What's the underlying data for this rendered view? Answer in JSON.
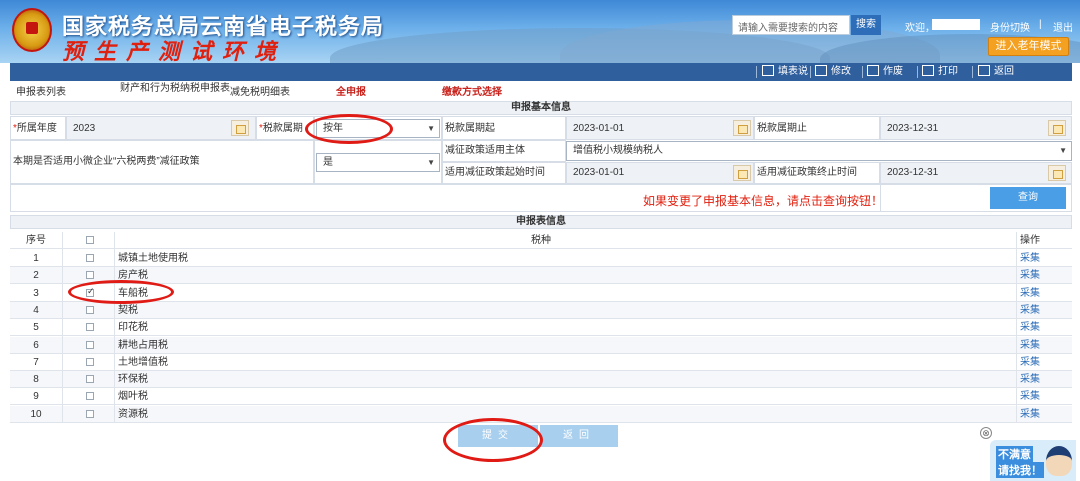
{
  "header": {
    "title": "国家税务总局云南省电子税务局",
    "env_title": "预生产测试环境",
    "search_placeholder": "请输入需要搜索的内容",
    "search_button": "搜索",
    "welcome": "欢迎，",
    "switch_identity": "身份切换",
    "separator": "|",
    "logout": "退出",
    "elder_mode": "进入老年模式"
  },
  "toolbar": {
    "items": [
      "填表说",
      "修改",
      "作废",
      "打印",
      "返回"
    ]
  },
  "tabs": [
    "申报表列表",
    "财产和行为税纳税申报表",
    "减免税明细表",
    "全申报",
    "缴款方式选择"
  ],
  "basic_info": {
    "section_title": "申报基本信息",
    "year_label": "所属年度",
    "year_value": "2023",
    "period_label": "税款属期",
    "period_value": "按年",
    "start_label": "税款属期起",
    "start_value": "2023-01-01",
    "end_label": "税款属期止",
    "end_value": "2023-12-31",
    "policy_label": "本期是否适用小微企业“六税两费”减征政策",
    "policy_value": "是",
    "subject_label": "减征政策适用主体",
    "subject_value": "增值税小规模纳税人",
    "policy_start_label": "适用减征政策起始时间",
    "policy_start_value": "2023-01-01",
    "policy_end_label": "适用减征政策终止时间",
    "policy_end_value": "2023-12-31",
    "notice": "如果变更了申报基本信息，请点击查询按钮！",
    "query_button": "查询"
  },
  "tax_table": {
    "section_title": "申报表信息",
    "headers": {
      "no": "序号",
      "name": "税种",
      "op": "操作"
    },
    "rows": [
      {
        "no": "1",
        "name": "城镇土地使用税",
        "checked": false,
        "op": "采集"
      },
      {
        "no": "2",
        "name": "房产税",
        "checked": false,
        "op": "采集"
      },
      {
        "no": "3",
        "name": "车船税",
        "checked": true,
        "op": "采集"
      },
      {
        "no": "4",
        "name": "契税",
        "checked": false,
        "op": "采集"
      },
      {
        "no": "5",
        "name": "印花税",
        "checked": false,
        "op": "采集"
      },
      {
        "no": "6",
        "name": "耕地占用税",
        "checked": false,
        "op": "采集"
      },
      {
        "no": "7",
        "name": "土地增值税",
        "checked": false,
        "op": "采集"
      },
      {
        "no": "8",
        "name": "环保税",
        "checked": false,
        "op": "采集"
      },
      {
        "no": "9",
        "name": "烟叶税",
        "checked": false,
        "op": "采集"
      },
      {
        "no": "10",
        "name": "资源税",
        "checked": false,
        "op": "采集"
      }
    ]
  },
  "actions": {
    "submit": "提交",
    "back": "返回"
  },
  "help_widget": {
    "line1": "不满意",
    "line2": "请找我！",
    "close": "⊗"
  },
  "colors": {
    "accent": "#2f5f9d",
    "highlight": "#e0200f",
    "button": "#4a9ee5"
  }
}
